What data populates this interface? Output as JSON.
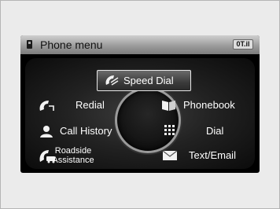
{
  "header": {
    "title": "Phone menu",
    "status": "0T.il"
  },
  "menu": {
    "speed_dial": "Speed Dial",
    "redial": "Redial",
    "phonebook": "Phonebook",
    "call_history": "Call History",
    "dial": "Dial",
    "roadside_line1": "Roadside",
    "roadside_line2": "Assistance",
    "text_email": "Text/Email"
  },
  "icons": {
    "phone": "phone-icon",
    "speed_dial": "speed-dial-icon",
    "redial": "redial-icon",
    "phonebook": "phonebook-icon",
    "call_history": "call-history-icon",
    "dial": "keypad-icon",
    "roadside": "roadside-assistance-icon",
    "text_email": "envelope-icon"
  }
}
